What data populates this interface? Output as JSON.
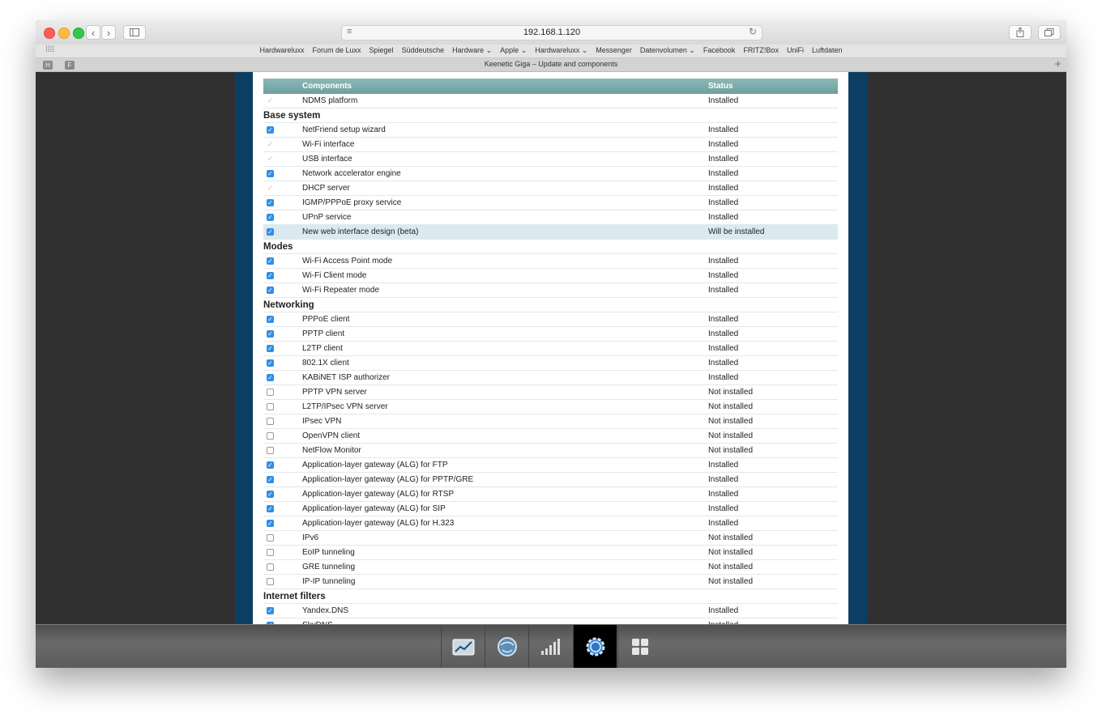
{
  "browser": {
    "address": "192.168.1.120",
    "bookmarks": [
      "Hardwareluxx",
      "Forum de Luxx",
      "Spiegel",
      "Süddeutsche",
      "Hardware ⌄",
      "Apple ⌄",
      "Hardwareluxx ⌄",
      "Messenger",
      "Datenvolumen ⌄",
      "Facebook",
      "FRITZ!Box",
      "UniFi",
      "Luftdaten"
    ],
    "tab_title": "Keenetic Giga – Update and components",
    "tab_letters": [
      "H",
      "F"
    ]
  },
  "table": {
    "col_components": "Components",
    "col_status": "Status"
  },
  "rows": [
    {
      "type": "item",
      "check": "disabled",
      "name": "NDMS platform",
      "status": "Installed"
    },
    {
      "type": "section",
      "name": "Base system"
    },
    {
      "type": "item",
      "check": "on",
      "name": "NetFriend setup wizard",
      "status": "Installed"
    },
    {
      "type": "item",
      "check": "disabled",
      "name": "Wi-Fi interface",
      "status": "Installed"
    },
    {
      "type": "item",
      "check": "disabled",
      "name": "USB interface",
      "status": "Installed"
    },
    {
      "type": "item",
      "check": "on",
      "name": "Network accelerator engine",
      "status": "Installed"
    },
    {
      "type": "item",
      "check": "disabled",
      "name": "DHCP server",
      "status": "Installed"
    },
    {
      "type": "item",
      "check": "on",
      "name": "IGMP/PPPoE proxy service",
      "status": "Installed"
    },
    {
      "type": "item",
      "check": "on",
      "name": "UPnP service",
      "status": "Installed"
    },
    {
      "type": "item",
      "check": "on",
      "name": "New web interface design (beta)",
      "status": "Will be installed",
      "highlight": true
    },
    {
      "type": "section",
      "name": "Modes"
    },
    {
      "type": "item",
      "check": "on",
      "name": "Wi-Fi Access Point mode",
      "status": "Installed"
    },
    {
      "type": "item",
      "check": "on",
      "name": "Wi-Fi Client mode",
      "status": "Installed"
    },
    {
      "type": "item",
      "check": "on",
      "name": "Wi-Fi Repeater mode",
      "status": "Installed"
    },
    {
      "type": "section",
      "name": "Networking"
    },
    {
      "type": "item",
      "check": "on",
      "name": "PPPoE client",
      "status": "Installed"
    },
    {
      "type": "item",
      "check": "on",
      "name": "PPTP client",
      "status": "Installed"
    },
    {
      "type": "item",
      "check": "on",
      "name": "L2TP client",
      "status": "Installed"
    },
    {
      "type": "item",
      "check": "on",
      "name": "802.1X client",
      "status": "Installed"
    },
    {
      "type": "item",
      "check": "on",
      "name": "KABiNET ISP authorizer",
      "status": "Installed"
    },
    {
      "type": "item",
      "check": "off",
      "name": "PPTP VPN server",
      "status": "Not installed"
    },
    {
      "type": "item",
      "check": "off",
      "name": "L2TP/IPsec VPN server",
      "status": "Not installed"
    },
    {
      "type": "item",
      "check": "off",
      "name": "IPsec VPN",
      "status": "Not installed"
    },
    {
      "type": "item",
      "check": "off",
      "name": "OpenVPN client",
      "status": "Not installed"
    },
    {
      "type": "item",
      "check": "off",
      "name": "NetFlow Monitor",
      "status": "Not installed"
    },
    {
      "type": "item",
      "check": "on",
      "name": "Application-layer gateway (ALG) for FTP",
      "status": "Installed"
    },
    {
      "type": "item",
      "check": "on",
      "name": "Application-layer gateway (ALG) for PPTP/GRE",
      "status": "Installed"
    },
    {
      "type": "item",
      "check": "on",
      "name": "Application-layer gateway (ALG) for RTSP",
      "status": "Installed"
    },
    {
      "type": "item",
      "check": "on",
      "name": "Application-layer gateway (ALG) for SIP",
      "status": "Installed"
    },
    {
      "type": "item",
      "check": "on",
      "name": "Application-layer gateway (ALG) for H.323",
      "status": "Installed"
    },
    {
      "type": "item",
      "check": "off",
      "name": "IPv6",
      "status": "Not installed"
    },
    {
      "type": "item",
      "check": "off",
      "name": "EoIP tunneling",
      "status": "Not installed"
    },
    {
      "type": "item",
      "check": "off",
      "name": "GRE tunneling",
      "status": "Not installed"
    },
    {
      "type": "item",
      "check": "off",
      "name": "IP-IP tunneling",
      "status": "Not installed"
    },
    {
      "type": "section",
      "name": "Internet filters"
    },
    {
      "type": "item",
      "check": "on",
      "name": "Yandex.DNS",
      "status": "Installed"
    },
    {
      "type": "item",
      "check": "on",
      "name": "SkyDNS",
      "status": "Installed"
    }
  ],
  "dock": {
    "items": [
      "stats-icon",
      "globe-icon",
      "signal-icon",
      "gear-icon",
      "apps-icon"
    ],
    "active": "gear-icon"
  },
  "colors": {
    "header_teal": "#7aa9a9",
    "frame_blue": "#0c3e63",
    "checkbox_blue": "#2f8ee6",
    "highlight_row": "#dbeaf0"
  }
}
